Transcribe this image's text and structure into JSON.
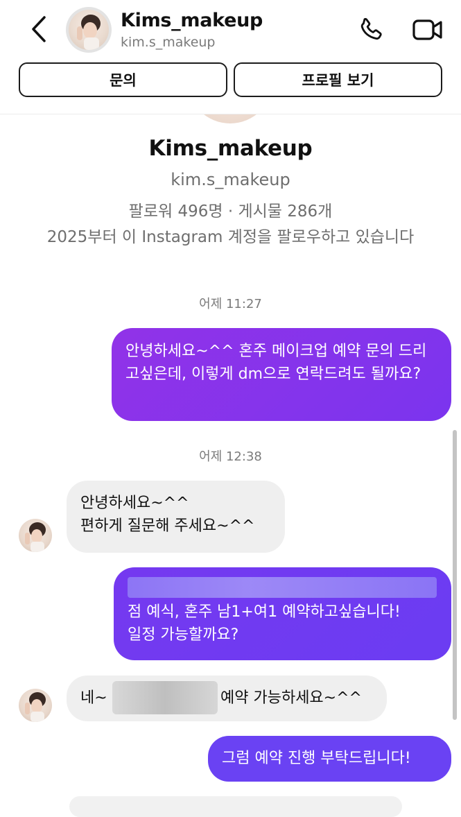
{
  "header": {
    "back_icon": "chevron-left-icon",
    "name": "Kims_makeup",
    "handle": "kim.s_makeup",
    "call_icon": "phone-icon",
    "video_icon": "video-camera-icon",
    "buttons": [
      "문의",
      "프로필 보기"
    ]
  },
  "profile": {
    "name": "Kims_makeup",
    "handle": "kim.s_makeup",
    "stats": "팔로워 496명 · 게시물 286개",
    "follow_info": "2025부터 이 Instagram 계정을 팔로우하고 있습니다"
  },
  "messages": {
    "timestamp_1": "어제 11:27",
    "m1": "안녕하세요~^^ 혼주 메이크업 예약 문의 드리고싶은데, 이렇게 dm으로 연락드려도 될까요?",
    "timestamp_2": "어제 12:38",
    "m2_line1": "안녕하세요~^^",
    "m2_line2": "편하게 질문해 주세요~^^",
    "m3_line2": "점 예식, 혼주 남1+여1 예약하고싶습니다!",
    "m3_line3": "일정 가능할까요?",
    "m4_prefix": "네~",
    "m4_suffix": "예약 가능하세요~^^",
    "m5": "그럼 예약 진행 부탁드립니다!"
  },
  "colors": {
    "outgoing_bubble_start": "#9133e8",
    "outgoing_bubble_end": "#6a42f3",
    "incoming_bubble": "#efefef",
    "secondary_text": "#6e6e6e"
  }
}
